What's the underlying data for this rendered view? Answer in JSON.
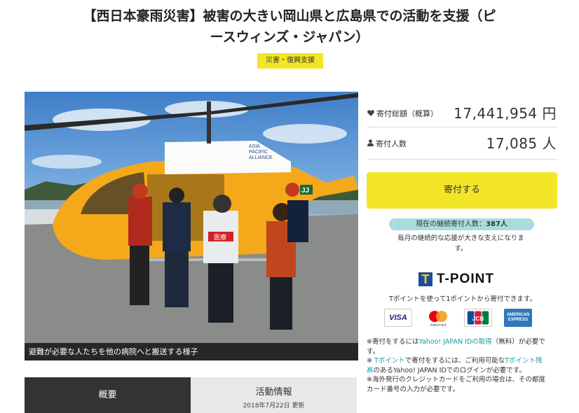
{
  "title_line1": "【西日本豪雨災害】被害の大きい岡山県と広島県での活動を支援（ピ",
  "title_line2": "ースウィンズ・ジャパン）",
  "badge": "災害・復興支援",
  "photo": {
    "caption": "避難が必要な人たちを他の病院へと搬送する様子",
    "heli_text1": "ASIA",
    "heli_text2": "PACIFIC",
    "heli_text3": "ALLIANCE",
    "tail_logo": "JJ",
    "vest_text": "医療"
  },
  "tabs": {
    "overview": "概要",
    "activity": "活動情報",
    "activity_date": "2018年7月22日 更新"
  },
  "stats": {
    "total_label": "寄付総額（概算）",
    "total_value": "17,441,954 円",
    "donors_label": "寄付人数",
    "donors_value": "17,085 人"
  },
  "donate_button": "寄付する",
  "monthly": {
    "pill_prefix": "現在の継続寄付人数：",
    "pill_count": "387人",
    "note_line1": "毎月の継続的な応援が大きな支えになりま",
    "note_line2": "す。"
  },
  "tpoint": {
    "mark": "T",
    "name": "T-POINT",
    "desc": "Tポイントを使って1ポイントから寄付できます。"
  },
  "cards": {
    "visa": "VISA",
    "mastercard": "mastercard",
    "jcb": "JCB",
    "amex_line1": "AMERICAN",
    "amex_line2": "EXPRESS"
  },
  "notes": {
    "n1_a": "※寄付をするには",
    "n1_link": "Yahoo! JAPAN IDの取得",
    "n1_b": "（無料）が必要で",
    "n1_c": "す。",
    "n2_a": "※ ",
    "n2_link1": "Tポイント",
    "n2_b": "で寄付をするには、ご利用可能な",
    "n2_link2": "Tポイント残",
    "n2_link3": "高",
    "n2_c": "のあるYahoo! JAPAN IDでのログインが必要です。",
    "n3": "※海外発行のクレジットカードをご利用の場合は、その都度",
    "n3_b": "カード番号の入力が必要です。"
  },
  "colors": {
    "accent_yellow": "#f2e627",
    "pill_teal": "#a9dcdc",
    "link": "#1a9aa8",
    "tab_dark": "#333333"
  }
}
